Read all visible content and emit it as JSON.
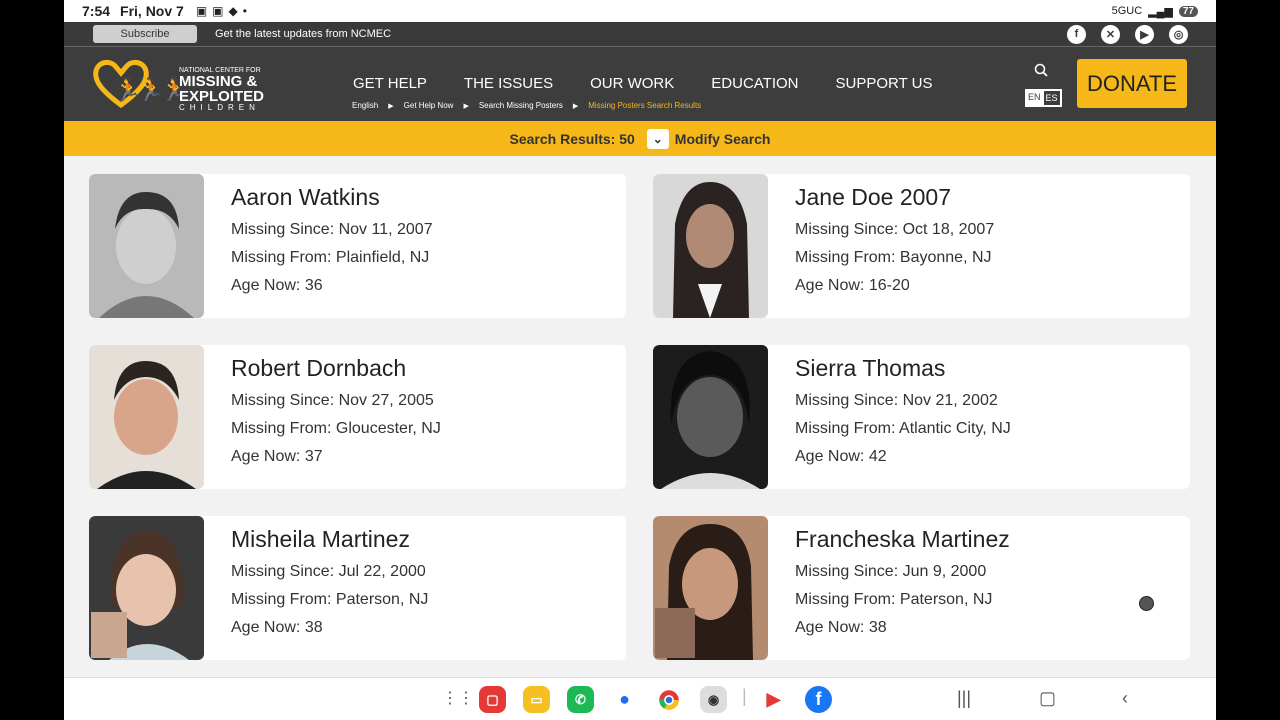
{
  "status": {
    "time": "7:54",
    "date": "Fri, Nov 7",
    "network": "5GUC",
    "battery": "77"
  },
  "update_bar": {
    "subscribe_label": "Subscribe",
    "text": "Get the latest updates from NCMEC"
  },
  "logo": {
    "line1": "NATIONAL CENTER FOR",
    "line2": "MISSING &",
    "line3": "EXPLOITED",
    "line4": "CHILDREN"
  },
  "nav": [
    "GET HELP",
    "THE ISSUES",
    "OUR WORK",
    "EDUCATION",
    "SUPPORT US"
  ],
  "breadcrumbs": [
    "English",
    "Get Help Now",
    "Search Missing Posters",
    "Missing Posters Search Results"
  ],
  "lang": {
    "en": "EN",
    "es": "ES"
  },
  "donate_label": "DONATE",
  "results": {
    "label": "Search Results: 50",
    "modify_label": "Modify Search"
  },
  "colors": {
    "accent": "#f6b818",
    "header_bg": "#3d3d3d"
  },
  "cards": [
    {
      "name": "Aaron Watkins",
      "since": "Missing Since: Nov 11, 2007",
      "from": "Missing From: Plainfield, NJ",
      "age": "Age Now: 36"
    },
    {
      "name": "Jane Doe 2007",
      "since": "Missing Since: Oct 18, 2007",
      "from": "Missing From: Bayonne, NJ",
      "age": "Age Now: 16-20"
    },
    {
      "name": "Robert Dornbach",
      "since": "Missing Since: Nov 27, 2005",
      "from": "Missing From: Gloucester, NJ",
      "age": "Age Now: 37"
    },
    {
      "name": "Sierra Thomas",
      "since": "Missing Since: Nov 21, 2002",
      "from": "Missing From: Atlantic City, NJ",
      "age": "Age Now: 42"
    },
    {
      "name": "Misheila Martinez",
      "since": "Missing Since: Jul 22, 2000",
      "from": "Missing From: Paterson, NJ",
      "age": "Age Now: 38"
    },
    {
      "name": "Francheska Martinez",
      "since": "Missing Since: Jun 9, 2000",
      "from": "Missing From: Paterson, NJ",
      "age": "Age Now: 38"
    }
  ]
}
